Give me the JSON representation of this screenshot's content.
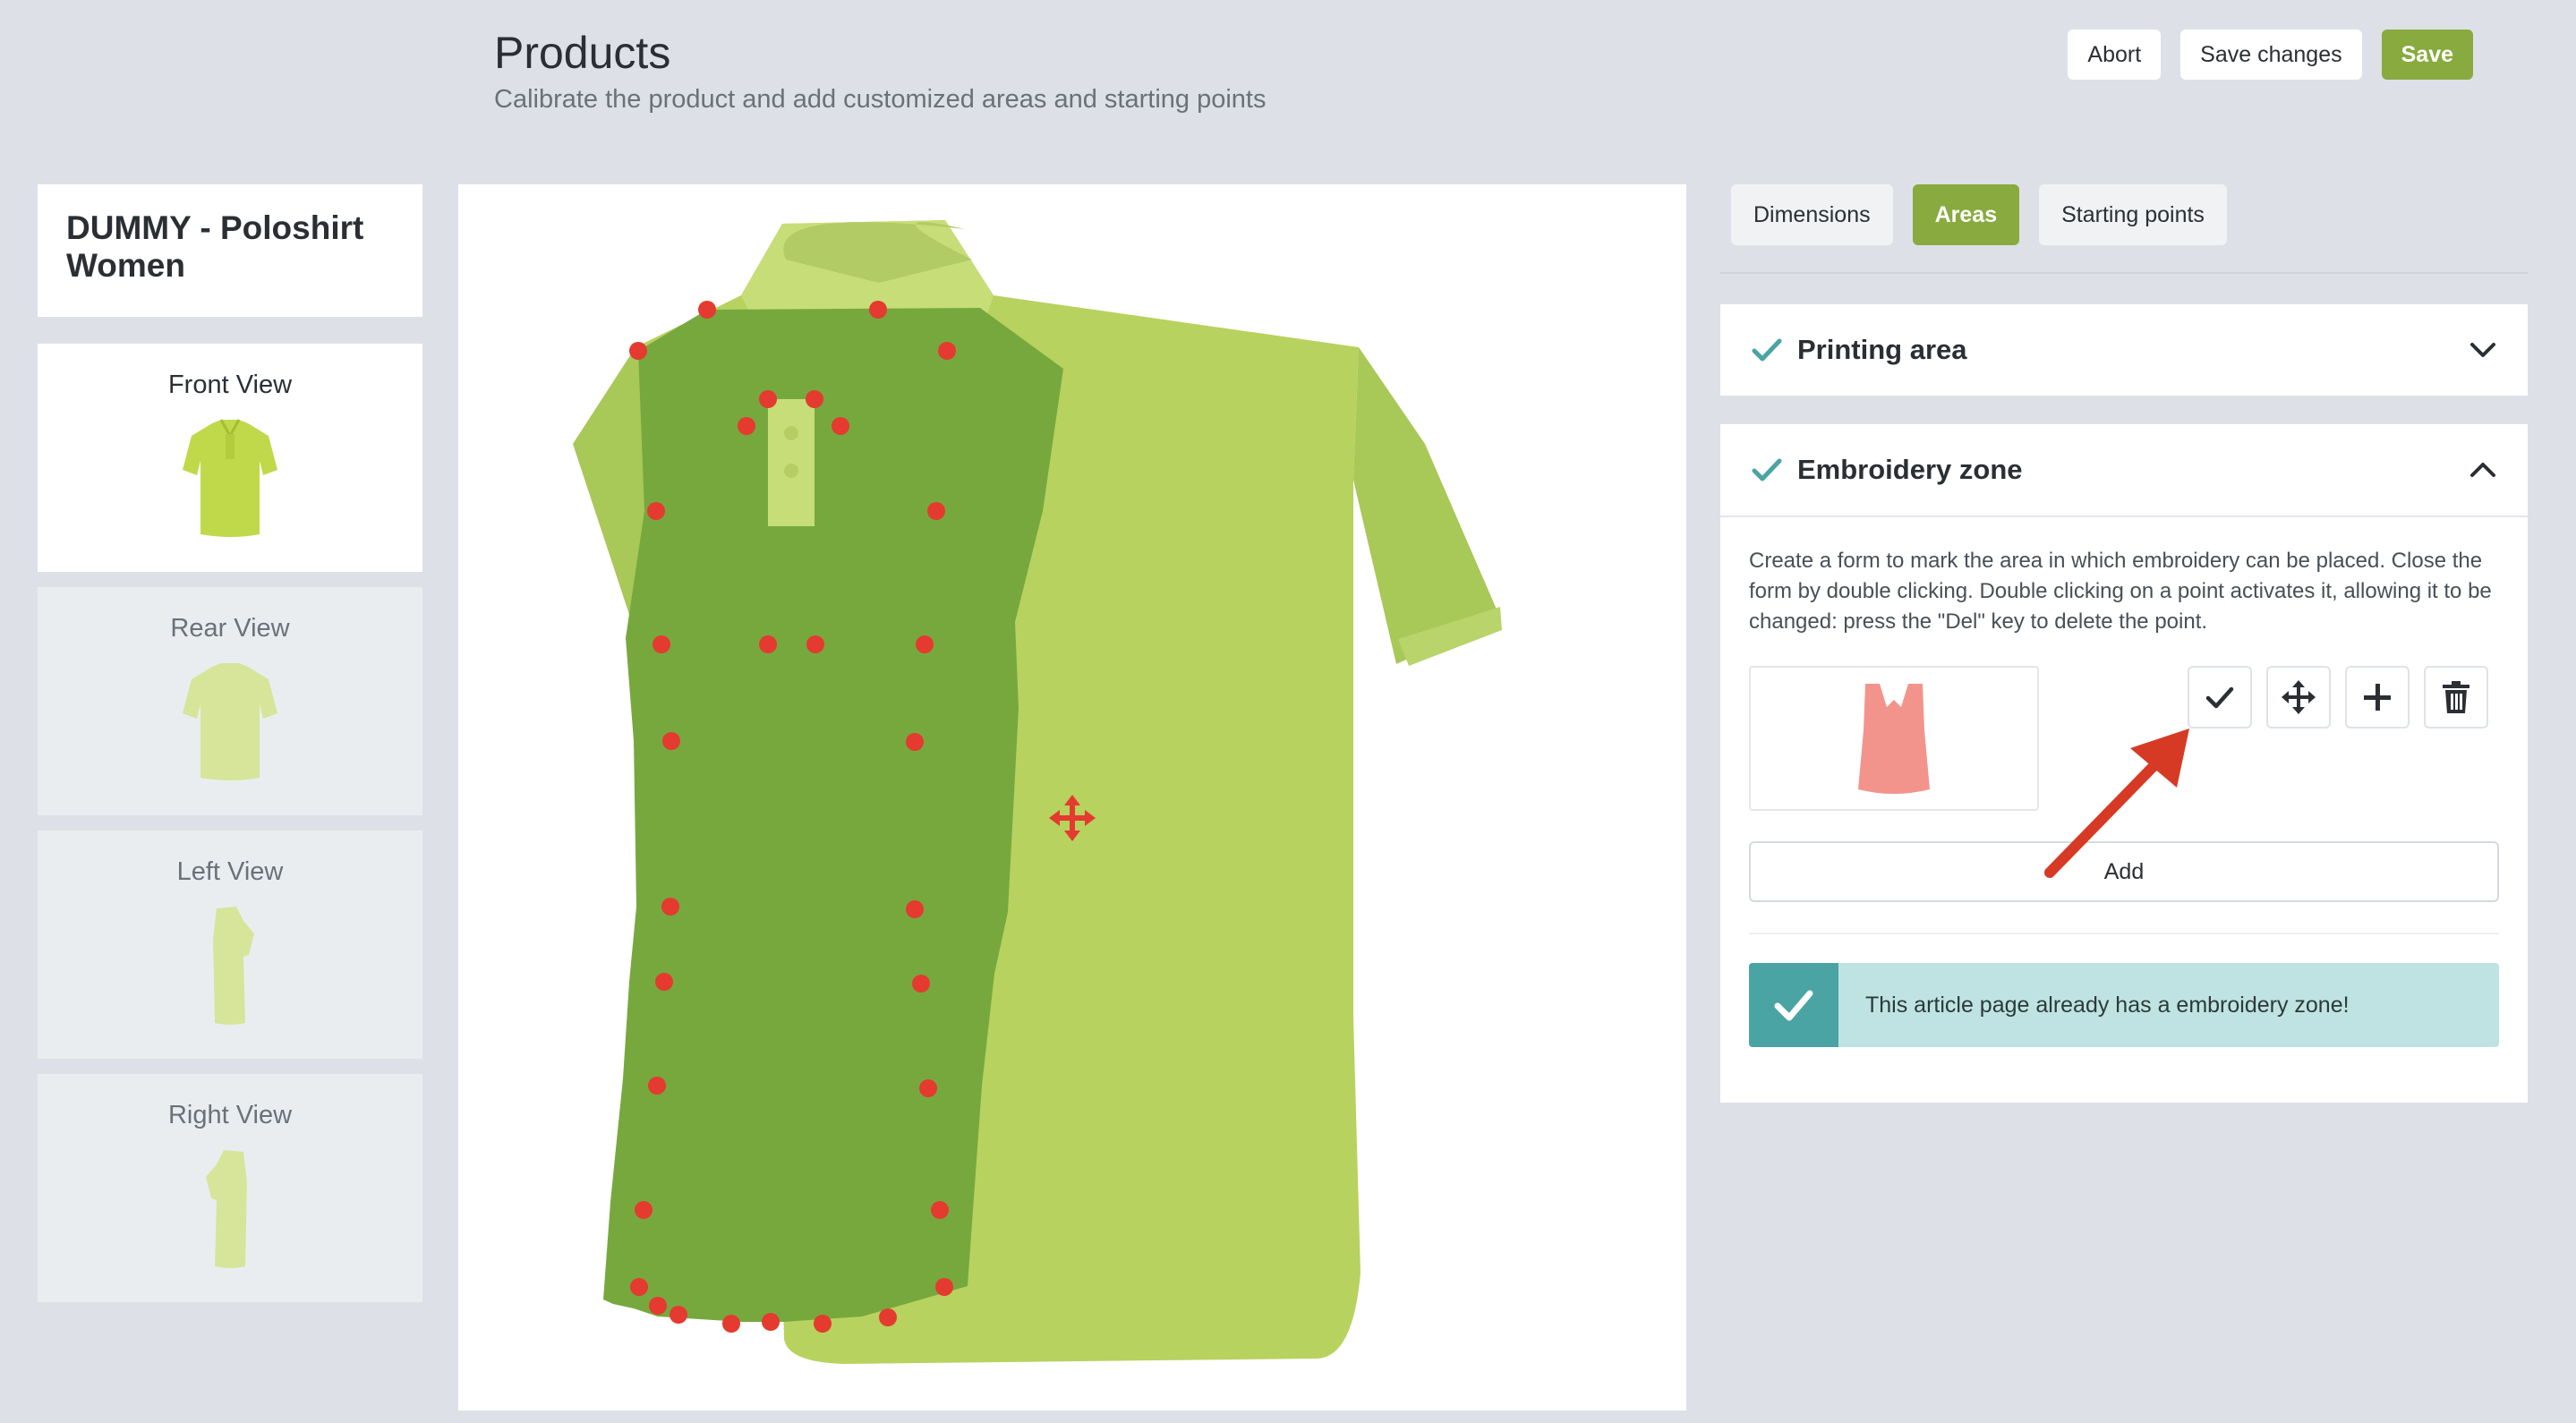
{
  "header": {
    "title": "Products",
    "subtitle": "Calibrate the product and add customized areas and starting points",
    "abort_label": "Abort",
    "save_changes_label": "Save changes",
    "save_label": "Save"
  },
  "product": {
    "name": "DUMMY - Poloshirt Women"
  },
  "views": [
    {
      "label": "Front View",
      "active": true
    },
    {
      "label": "Rear View",
      "active": false
    },
    {
      "label": "Left View",
      "active": false
    },
    {
      "label": "Right View",
      "active": false
    }
  ],
  "tabs": [
    {
      "label": "Dimensions",
      "active": false
    },
    {
      "label": "Areas",
      "active": true
    },
    {
      "label": "Starting points",
      "active": false
    }
  ],
  "panels": {
    "printing_area": {
      "title": "Printing area",
      "expanded": false
    },
    "embroidery_zone": {
      "title": "Embroidery zone",
      "expanded": true,
      "description": "Create a form to mark the area in which embroidery can be placed. Close the form by double clicking. Double clicking on a point activates it, allowing it to be changed: press the \"Del\" key to delete the point.",
      "tools": [
        "check-icon",
        "move-icon",
        "plus-icon",
        "trash-icon"
      ],
      "add_label": "Add",
      "alert_text": "This article page already has a embroidery zone!"
    }
  },
  "colors": {
    "accent_green": "#88aa3e",
    "shirt_light": "#c3d86a",
    "zone_green": "#77a83e",
    "point_red": "#e43a2f",
    "alert_teal": "#4aa4a3",
    "alert_bg": "#bfe3e2",
    "arrow_red": "#d63a25"
  }
}
